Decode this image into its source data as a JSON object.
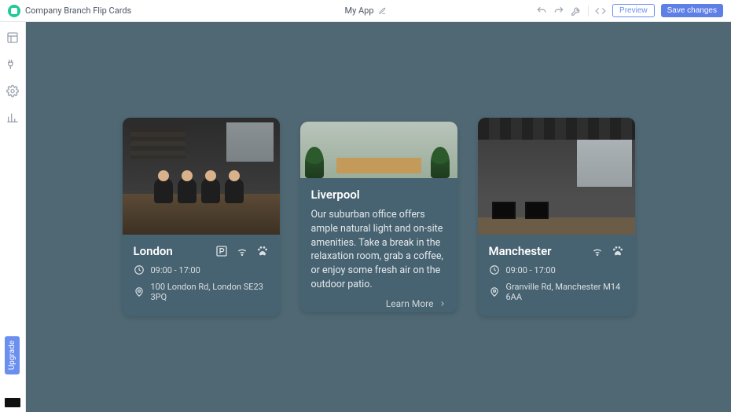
{
  "topbar": {
    "title": "Company Branch Flip Cards",
    "app_name": "My App",
    "preview_label": "Preview",
    "save_label": "Save changes"
  },
  "sidebar": {
    "upgrade_label": "Upgrade",
    "nav": [
      "layout",
      "plugins",
      "settings",
      "analytics"
    ]
  },
  "cards": [
    {
      "side": "front",
      "title": "London",
      "amenities": [
        "parking",
        "wifi",
        "pets"
      ],
      "hours": "09:00 - 17:00",
      "address": "100 London Rd, London SE23 3PQ"
    },
    {
      "side": "back",
      "title": "Liverpool",
      "description": "Our suburban office offers ample natural light and on-site amenities. Take a break in the relaxation room, grab a coffee, or enjoy some fresh air on the outdoor patio.",
      "learn_more_label": "Learn More"
    },
    {
      "side": "front",
      "title": "Manchester",
      "amenities": [
        "wifi",
        "pets"
      ],
      "hours": "09:00 - 17:00",
      "address": "Granville Rd, Manchester M14 6AA"
    }
  ]
}
